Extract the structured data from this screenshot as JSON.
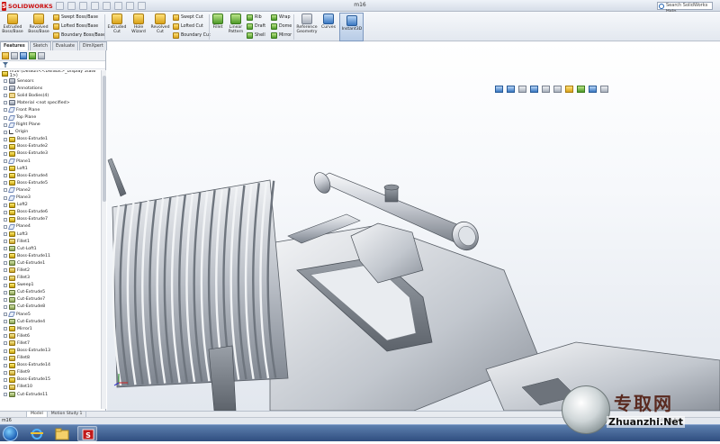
{
  "app": {
    "brand": "SOLIDWORKS",
    "document_title": "m16",
    "search_placeholder": "Search SolidWorks Help"
  },
  "ribbon": {
    "extruded_boss": "Extruded Boss/Base",
    "revolved_boss": "Revolved Boss/Base",
    "swept_boss": "Swept Boss/Base",
    "lofted_boss": "Lofted Boss/Base",
    "boundary_boss": "Boundary Boss/Base",
    "extruded_cut": "Extruded Cut",
    "hole_wizard": "Hole Wizard",
    "revolved_cut": "Revolved Cut",
    "swept_cut": "Swept Cut",
    "lofted_cut": "Lofted Cut",
    "boundary_cut": "Boundary Cut",
    "fillet": "Fillet",
    "linear_pattern": "Linear Pattern",
    "rib": "Rib",
    "draft": "Draft",
    "shell": "Shell",
    "wrap": "Wrap",
    "dome": "Dome",
    "mirror": "Mirror",
    "reference_geometry": "Reference Geometry",
    "curves": "Curves",
    "instant3d": "Instant3D"
  },
  "tabs": [
    "Features",
    "Sketch",
    "Evaluate",
    "DimXpert",
    "Office Products"
  ],
  "feature_tree": {
    "root": "m16 (Default<<Default>_Display State 1>)",
    "items": [
      {
        "label": "Sensors",
        "icon": "sensor-icon"
      },
      {
        "label": "Annotations",
        "icon": "annotations-icon"
      },
      {
        "label": "Solid Bodies(4)",
        "icon": "folder-icon"
      },
      {
        "label": "Material <not specified>",
        "icon": "material-icon"
      },
      {
        "label": "Front Plane",
        "icon": "plane-icon"
      },
      {
        "label": "Top Plane",
        "icon": "plane-icon"
      },
      {
        "label": "Right Plane",
        "icon": "plane-icon"
      },
      {
        "label": "Origin",
        "icon": "origin-icon"
      },
      {
        "label": "Boss-Extrude1",
        "icon": "extrude-icon"
      },
      {
        "label": "Boss-Extrude2",
        "icon": "extrude-icon"
      },
      {
        "label": "Boss-Extrude3",
        "icon": "extrude-icon"
      },
      {
        "label": "Plane1",
        "icon": "plane-icon"
      },
      {
        "label": "Loft1",
        "icon": "loft-icon"
      },
      {
        "label": "Boss-Extrude4",
        "icon": "extrude-icon"
      },
      {
        "label": "Boss-Extrude5",
        "icon": "extrude-icon"
      },
      {
        "label": "Plane2",
        "icon": "plane-icon"
      },
      {
        "label": "Plane3",
        "icon": "plane-icon"
      },
      {
        "label": "Loft2",
        "icon": "loft-icon"
      },
      {
        "label": "Boss-Extrude6",
        "icon": "extrude-icon"
      },
      {
        "label": "Boss-Extrude7",
        "icon": "extrude-icon"
      },
      {
        "label": "Plane4",
        "icon": "plane-icon"
      },
      {
        "label": "Loft3",
        "icon": "loft-icon"
      },
      {
        "label": "Fillet1",
        "icon": "fillet-icon"
      },
      {
        "label": "Cut-Loft1",
        "icon": "cut-icon"
      },
      {
        "label": "Boss-Extrude11",
        "icon": "extrude-icon"
      },
      {
        "label": "Cut-Extrude1",
        "icon": "cut-icon"
      },
      {
        "label": "Fillet2",
        "icon": "fillet-icon"
      },
      {
        "label": "Fillet3",
        "icon": "fillet-icon"
      },
      {
        "label": "Sweep1",
        "icon": "sweep-icon"
      },
      {
        "label": "Cut-Extrude5",
        "icon": "cut-icon"
      },
      {
        "label": "Cut-Extrude7",
        "icon": "cut-icon"
      },
      {
        "label": "Cut-Extrude8",
        "icon": "cut-icon"
      },
      {
        "label": "Plane5",
        "icon": "plane-icon"
      },
      {
        "label": "Cut-Extrude4",
        "icon": "cut-icon"
      },
      {
        "label": "Mirror1",
        "icon": "mirror-icon"
      },
      {
        "label": "Fillet6",
        "icon": "fillet-icon"
      },
      {
        "label": "Fillet7",
        "icon": "fillet-icon"
      },
      {
        "label": "Boss-Extrude13",
        "icon": "extrude-icon"
      },
      {
        "label": "Fillet8",
        "icon": "fillet-icon"
      },
      {
        "label": "Boss-Extrude14",
        "icon": "extrude-icon"
      },
      {
        "label": "Fillet9",
        "icon": "fillet-icon"
      },
      {
        "label": "Boss-Extrude15",
        "icon": "extrude-icon"
      },
      {
        "label": "Fillet10",
        "icon": "fillet-icon"
      },
      {
        "label": "Cut-Extrude11",
        "icon": "cut-icon"
      }
    ]
  },
  "bottom_tabs": [
    "Model",
    "Motion Study 1"
  ],
  "status": {
    "left": "m16",
    "right": "Editing Part"
  },
  "watermark": {
    "cn": "专取网",
    "en": "Zhuanzhi.Net"
  },
  "colors": {
    "accent": "#c11a1a",
    "taskbar": "#3f6296",
    "part_gray": "#b8bdc5"
  }
}
